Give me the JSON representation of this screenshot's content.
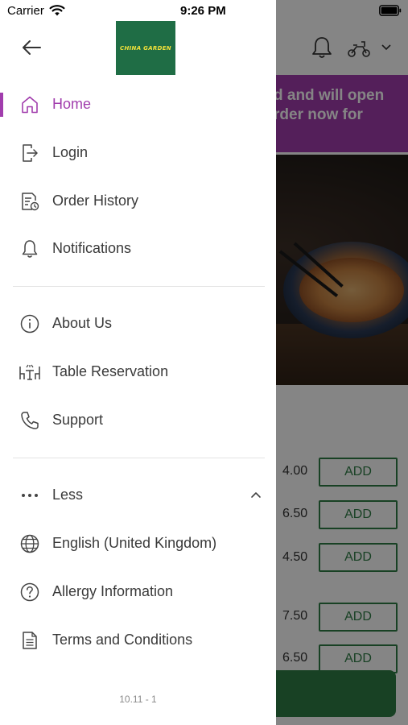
{
  "status_bar": {
    "carrier": "Carrier",
    "time": "9:26 PM"
  },
  "logo_text": "CHINA GARDEN",
  "menu": {
    "home": "Home",
    "login": "Login",
    "order_history": "Order History",
    "notifications": "Notifications",
    "about_us": "About Us",
    "table_reservation": "Table Reservation",
    "support": "Support",
    "less": "Less",
    "language": "English (United Kingdom)",
    "allergy": "Allergy Information",
    "terms": "Terms and Conditions"
  },
  "version": "10.11 - 1",
  "background": {
    "banner_line1": "d and will open",
    "banner_line2": "rder now for",
    "prices": [
      "4.00",
      "6.50",
      "4.50",
      "7.50",
      "6.50"
    ],
    "add_label": "ADD"
  },
  "colors": {
    "accent": "#a13dad",
    "brand_green": "#2f7d45",
    "logo_bg": "#1f6d45",
    "logo_text": "#f2e23a"
  },
  "icons": [
    "back-arrow-icon",
    "home-icon",
    "login-icon",
    "order-history-icon",
    "bell-icon",
    "info-icon",
    "table-icon",
    "phone-icon",
    "more-dots-icon",
    "chevron-up-icon",
    "globe-icon",
    "question-icon",
    "document-icon",
    "scooter-icon",
    "wifi-icon",
    "battery-icon"
  ]
}
